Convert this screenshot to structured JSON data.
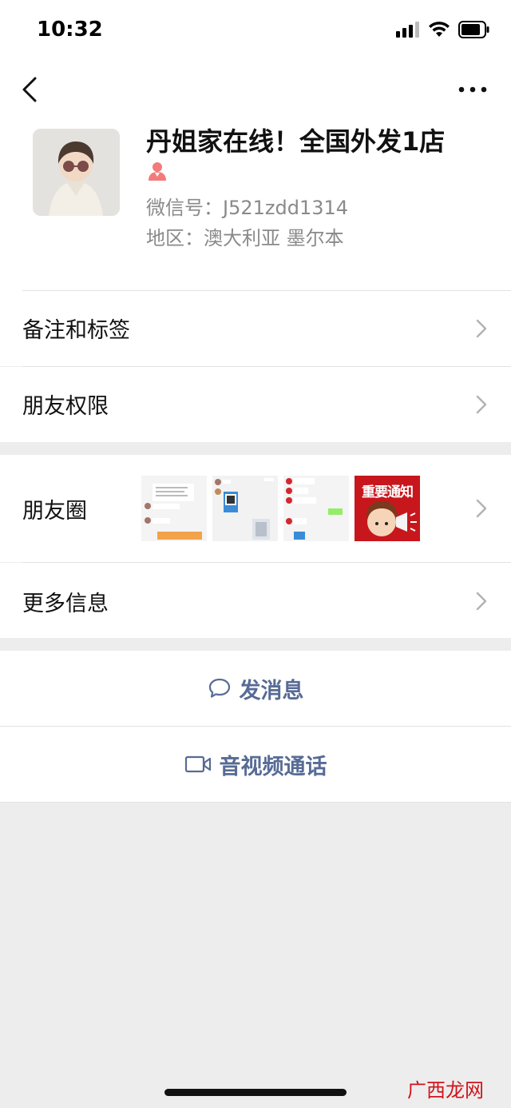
{
  "status_bar": {
    "time": "10:32"
  },
  "profile": {
    "name": "丹姐家在线！全国外发1店",
    "wechat_id": "微信号：J521zdd1314",
    "region": "地区：澳大利亚 墨尔本",
    "gender_icon": "female-icon",
    "gender_color": "#f27b7b"
  },
  "menu": {
    "notes_tags": "备注和标签",
    "friend_permissions": "朋友权限",
    "moments": "朋友圈",
    "more_info": "更多信息"
  },
  "moments_thumbs": [
    {
      "name": "chat-screenshot"
    },
    {
      "name": "qr-code-screenshot"
    },
    {
      "name": "chat-screenshot"
    },
    {
      "name": "notice-poster",
      "text": "重要通知"
    }
  ],
  "actions": {
    "send_message": "发消息",
    "video_call": "音视频通话"
  },
  "colors": {
    "link": "#576b95",
    "page_bg": "#ededed",
    "poster_red": "#c8161d"
  },
  "watermark": "广西龙网"
}
